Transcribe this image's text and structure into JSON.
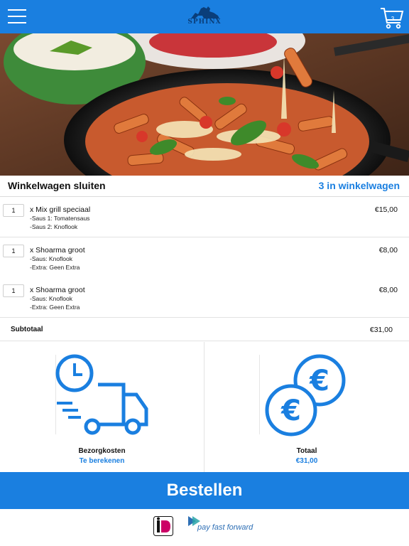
{
  "header": {
    "logo_text": "SPHINX",
    "cart_count": "3",
    "menu_icon": "hamburger-menu-icon",
    "cart_icon": "shopping-cart-icon"
  },
  "hero": {
    "description_icon": "food-photo"
  },
  "cart": {
    "close_label": "Winkelwagen sluiten",
    "count_label": "3 in winkelwagen",
    "items": [
      {
        "qty": "1",
        "name": "x Mix grill speciaal",
        "options": [
          "-Saus 1: Tomatensaus",
          "-Saus 2: Knoflook"
        ],
        "price": "€15,00"
      },
      {
        "qty": "1",
        "name": "x Shoarma groot",
        "options": [
          "-Saus: Knoflook",
          "-Extra: Geen Extra"
        ],
        "price": "€8,00"
      },
      {
        "qty": "1",
        "name": "x Shoarma groot",
        "options": [
          "-Saus: Knoflook",
          "-Extra: Geen Extra"
        ],
        "price": "€8,00"
      }
    ],
    "subtotal_label": "Subtotaal",
    "subtotal_value": "€31,00"
  },
  "summary": {
    "delivery_label": "Bezorgkosten",
    "delivery_value": "Te berekenen",
    "total_label": "Totaal",
    "total_value": "€31,00",
    "delivery_icon": "delivery-truck-clock-icon",
    "total_icon": "euro-coins-icon"
  },
  "order_button": "Bestellen",
  "footer": {
    "ideal_text": "iDEAL",
    "payff_text": "pay fast forward"
  },
  "colors": {
    "accent": "#1a7fe0"
  }
}
